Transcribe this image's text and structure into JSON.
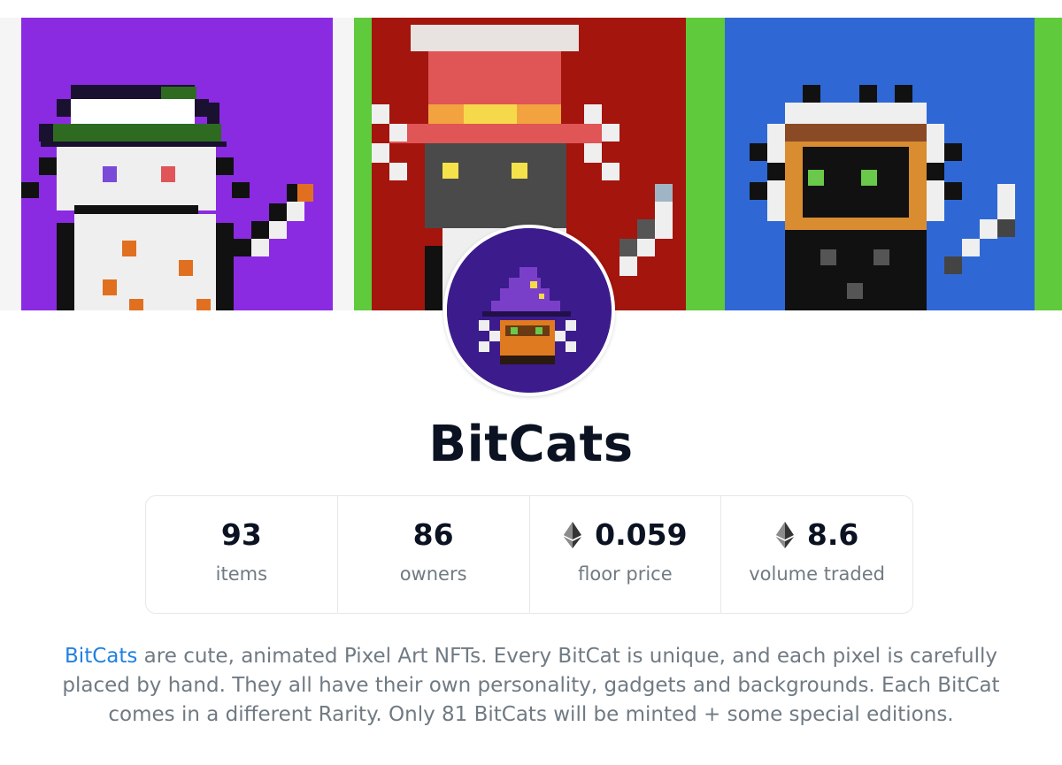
{
  "collection": {
    "name": "BitCats",
    "banner": {
      "panels": [
        {
          "subject": "bitcat with white cap",
          "background_color": "#8a2be2"
        },
        {
          "subject": "bitcat with red top hat",
          "background_color": "#a3150d"
        },
        {
          "subject": "bitcat with brown box head",
          "background_color": "#2f68d4"
        }
      ]
    },
    "avatar": {
      "subject": "bitcat with purple wizard hat",
      "background_color": "#3c1b8c"
    }
  },
  "stats": [
    {
      "value": "93",
      "label": "items",
      "icon": null
    },
    {
      "value": "86",
      "label": "owners",
      "icon": null
    },
    {
      "value": "0.059",
      "label": "floor price",
      "icon": "ethereum-icon"
    },
    {
      "value": "8.6",
      "label": "volume traded",
      "icon": "ethereum-icon"
    }
  ],
  "description": {
    "link_text": "BitCats",
    "text": " are cute, animated Pixel Art NFTs. Every BitCat is unique, and each pixel is carefully placed by hand. They all have their own personality, gadgets and backgrounds. Each BitCat comes in a different Rarity. Only 81 BitCats will be minted + some special editions."
  },
  "colors": {
    "link": "#2081e2",
    "muted_text": "#707a83",
    "title": "#0b1221",
    "border": "#e5e8eb"
  }
}
